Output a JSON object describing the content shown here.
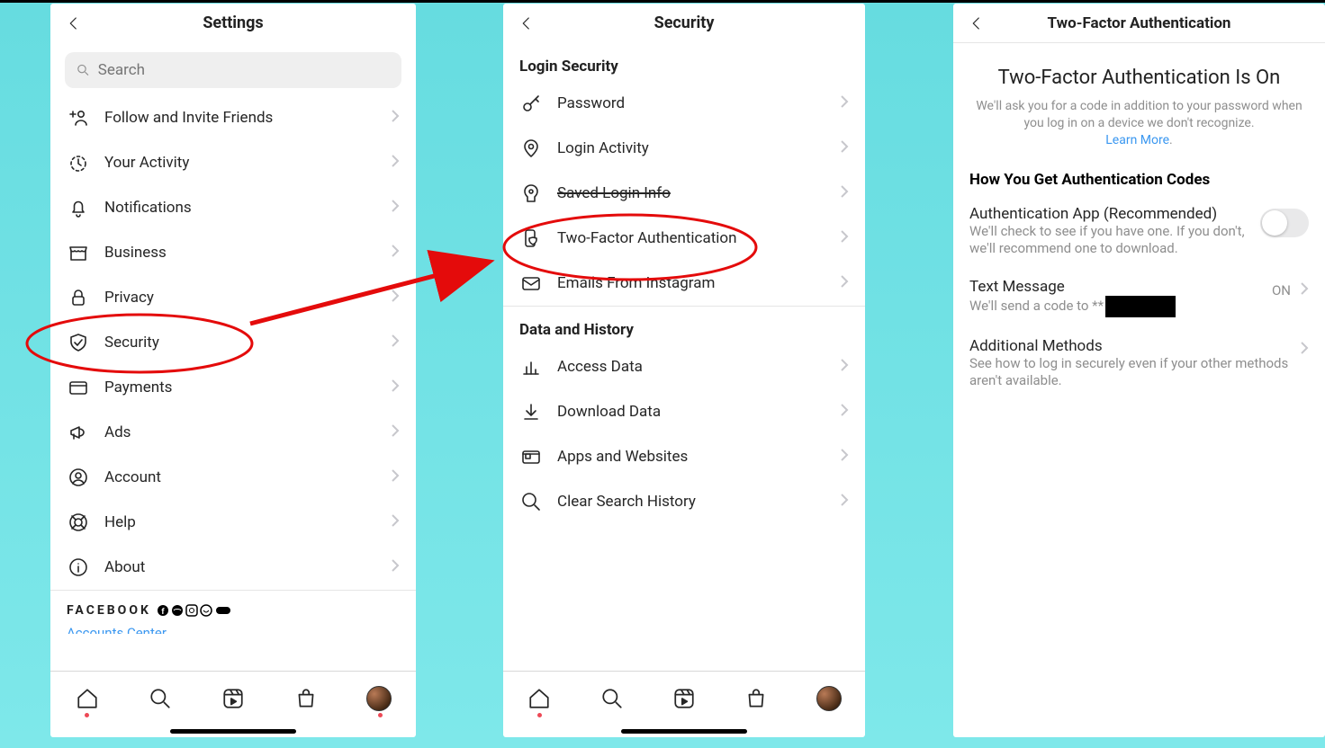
{
  "phone1": {
    "title": "Settings",
    "search_placeholder": "Search",
    "items": [
      {
        "label": "Follow and Invite Friends",
        "icon": "person-plus"
      },
      {
        "label": "Your Activity",
        "icon": "timer"
      },
      {
        "label": "Notifications",
        "icon": "bell"
      },
      {
        "label": "Business",
        "icon": "storefront"
      },
      {
        "label": "Privacy",
        "icon": "lock"
      },
      {
        "label": "Security",
        "icon": "shield"
      },
      {
        "label": "Payments",
        "icon": "card"
      },
      {
        "label": "Ads",
        "icon": "megaphone"
      },
      {
        "label": "Account",
        "icon": "user-circle"
      },
      {
        "label": "Help",
        "icon": "lifebuoy"
      },
      {
        "label": "About",
        "icon": "info"
      }
    ],
    "facebook_label": "FACEBOOK",
    "accounts_center": "Accounts Center"
  },
  "phone2": {
    "title": "Security",
    "section_login": "Login Security",
    "login_items": [
      {
        "label": "Password",
        "icon": "key"
      },
      {
        "label": "Login Activity",
        "icon": "location"
      },
      {
        "label": "Saved Login Info",
        "icon": "keyhole",
        "strike": true
      },
      {
        "label": "Two-Factor Authentication",
        "icon": "phone-shield"
      },
      {
        "label": "Emails From Instagram",
        "icon": "mail"
      }
    ],
    "section_data": "Data and History",
    "data_items": [
      {
        "label": "Access Data",
        "icon": "chart"
      },
      {
        "label": "Download Data",
        "icon": "download"
      },
      {
        "label": "Apps and Websites",
        "icon": "apps"
      },
      {
        "label": "Clear Search History",
        "icon": "search"
      }
    ]
  },
  "phone3": {
    "title": "Two-Factor Authentication",
    "big_heading": "Two-Factor Authentication Is On",
    "desc_line": "We'll ask you for a code in addition to your password when you log in on a device we don't recognize.",
    "learn_more": "Learn More",
    "section": "How You Get Authentication Codes",
    "auth_app_title": "Authentication App (Recommended)",
    "auth_app_sub": "We'll check to see if you have one. If you don't, we'll recommend one to download.",
    "text_msg_title": "Text Message",
    "text_msg_sub_prefix": "We'll send a code to **",
    "on_label": "ON",
    "additional_title": "Additional Methods",
    "additional_sub": "See how to log in securely even if your other methods aren't available."
  }
}
